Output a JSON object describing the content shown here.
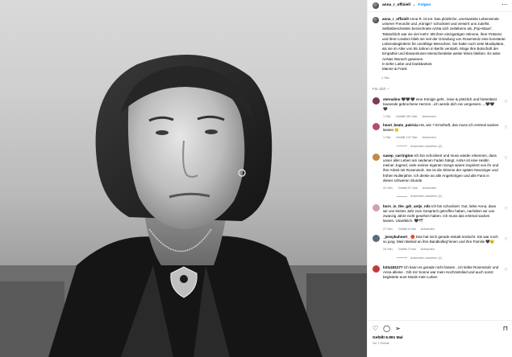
{
  "header": {
    "username": "anna_r_offiziell",
    "separator": "•",
    "follow_label": "Folgen",
    "more_icon": "more-horizontal-icon"
  },
  "caption": {
    "username": "anna_r_offiziell",
    "text": "Anna R. ist tot. Das plötzliche, unerwartete Lebensende unserer Freundin und „Königin“ schockiert und verwirrt uns zutiefst. Selbstbescheiden bezeichnete AnNa sich zeitlebens als „Pop-Maus“. Tatsächlich war sie viel mehr: Mit ihrer einzigartigen Stimme, ihrer Präsenz und ihren Liedern blieb sie seit der Gründung von Rosenstolz eine konstante Lebensbegleiterin für unzählige Menschen. Sie hatte noch viele Musikpläne, als sie im Alter von 55 Jahren in Berlin verstarb. Möge ihre Botschaft der Empathie und klassenlosen Menschenliebe weiter leben bleiben. Es wäre AnNas Wunsch gewesen.",
    "closing": "In tiefer Liebe und Dankbarkeit.",
    "signature": "Manne & Frank",
    "time": "1 Std."
  },
  "language_note": "Für dich ~",
  "comments": [
    {
      "username": "sternalino",
      "text": "🖤🖤🖤 eine Königin geht , leise & plötzlich und hinterlässt tausende gebrochene Herzen...ich werde dich nie vergessen.....🖤🖤🖤",
      "time": "1 Std.",
      "likes": "Gefällt 281 Mal",
      "reply": "Antworten",
      "avatar_color": "#7a3b5a"
    },
    {
      "username": "heart_beats_patricia",
      "text": "Hä, wie ? Ernsthaft, das muss ich erstmal sacken lassen 😔",
      "time": "1 Std.",
      "likes": "Gefällt 147 Mal",
      "reply": "Antworten",
      "replies": "Antworten ansehen (2)",
      "avatar_color": "#b84a6a"
    },
    {
      "username": "sasep_carrington",
      "text": "Ich bin schockiert und muss wieder erkennen, dass unser aller Leben am seidenen Faden hängt. AnNA ist eine Heldin meiner Jugend, viele meiner eigenen Songs waren inspiriert von ihr und ihre Arbeit mit Rosenstolz. Sie ist die Stimme der späten Neunziger und frühen Nullerjahre. Ich denke an alle Angehörigen und alle Fans in dieser schweren Stunde.",
      "time": "31 Min.",
      "likes": "Gefällt 57 Mal",
      "reply": "Antworten",
      "replies": "Antworten ansehen (1)",
      "avatar_color": "#c08a4a"
    },
    {
      "username": "born_in_the_gdr_antje_nils",
      "text": "Ich bin schockiert. Gut, liebe Anna, dass wir uns letztes Jahr zum Gespräch getroffen haben, nachdem wir uns zwanzig Jahre nicht gesehen haben. Ich muss das erstmal sacken lassen. Unwirklich. 🖤🕊",
      "time": "27 Min.",
      "likes": "Gefällt 6 Mal",
      "reply": "Antworten",
      "avatar_color": "#d2a0b0"
    },
    {
      "username": "_jessykuhnert_",
      "text": "🔴 Das hat mich gerade eiskalt erwischt. Sie war noch so jung. Mein Beileid an ihre Bandkolleg*innen und ihre Familie 🖤😢",
      "time": "24 Min.",
      "likes": "Gefällt 3 Mal",
      "reply": "Antworten",
      "replies": "Antworten ansehen (1)",
      "avatar_color": "#5a6a7a"
    },
    {
      "username": "lotta181277",
      "text": "Ich kann es gerade nicht fassen , ich liebte Rosenstolz und Anna alleine . Gib mir Sonne war mein Hochzeitslied und auch sonst begleitete eure Musik mein Leben",
      "time": "",
      "likes": "",
      "reply": "",
      "avatar_color": "#c43a3a"
    }
  ],
  "actions": {
    "likes": "Gefällt 6.991 Mal",
    "time": "Vor 1 Stunde",
    "icons": [
      "heart-icon",
      "comment-icon",
      "share-icon",
      "bookmark-icon"
    ]
  }
}
